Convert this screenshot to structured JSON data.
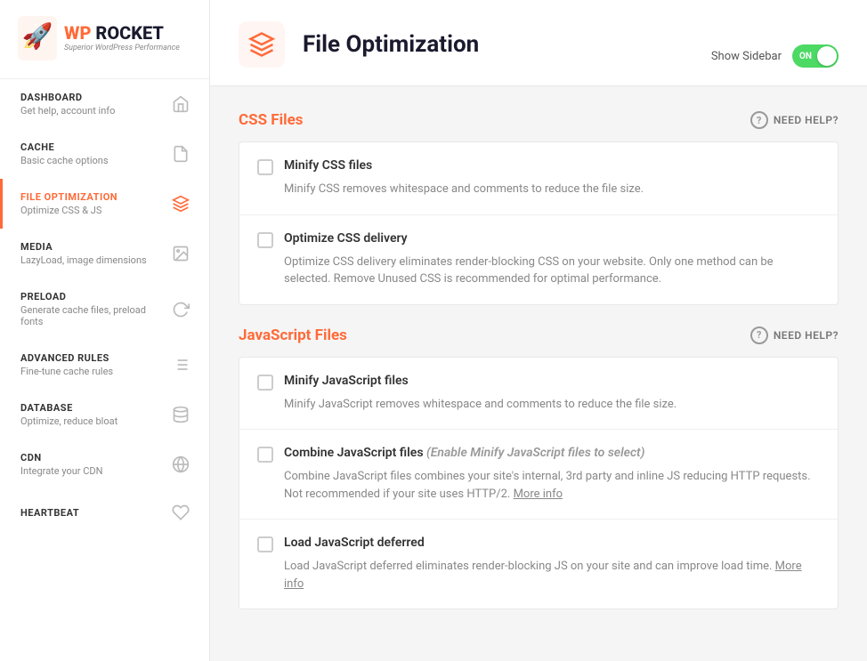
{
  "logo": {
    "wp": "WP",
    "rocket": "ROCKET",
    "subtitle": "Superior WordPress Performance"
  },
  "sidebar": {
    "items": [
      {
        "id": "dashboard",
        "title": "DASHBOARD",
        "desc": "Get help, account info",
        "icon": "house"
      },
      {
        "id": "cache",
        "title": "CACHE",
        "desc": "Basic cache options",
        "icon": "file"
      },
      {
        "id": "file-optimization",
        "title": "FILE OPTIMIZATION",
        "desc": "Optimize CSS & JS",
        "icon": "layers",
        "active": true
      },
      {
        "id": "media",
        "title": "MEDIA",
        "desc": "LazyLoad, image dimensions",
        "icon": "image"
      },
      {
        "id": "preload",
        "title": "PRELOAD",
        "desc": "Generate cache files, preload fonts",
        "icon": "refresh"
      },
      {
        "id": "advanced-rules",
        "title": "ADVANCED RULES",
        "desc": "Fine-tune cache rules",
        "icon": "list"
      },
      {
        "id": "database",
        "title": "DATABASE",
        "desc": "Optimize, reduce bloat",
        "icon": "database"
      },
      {
        "id": "cdn",
        "title": "CDN",
        "desc": "Integrate your CDN",
        "icon": "globe"
      },
      {
        "id": "heartbeat",
        "title": "HEARTBEAT",
        "desc": "",
        "icon": "heart"
      }
    ]
  },
  "header": {
    "title": "File Optimization",
    "show_sidebar_label": "Show Sidebar",
    "toggle_label": "ON"
  },
  "tabs": [
    {
      "id": "tab1",
      "label": ""
    }
  ],
  "css_section": {
    "title": "CSS Files",
    "need_help": "NEED HELP?",
    "rows": [
      {
        "id": "minify-css",
        "title": "Minify CSS files",
        "desc": "Minify CSS removes whitespace and comments to reduce the file size.",
        "checked": false
      },
      {
        "id": "optimize-css-delivery",
        "title": "Optimize CSS delivery",
        "desc": "Optimize CSS delivery eliminates render-blocking CSS on your website. Only one method can be selected. Remove Unused CSS is recommended for optimal performance.",
        "checked": false
      }
    ]
  },
  "js_section": {
    "title": "JavaScript Files",
    "need_help": "NEED HELP?",
    "rows": [
      {
        "id": "minify-js",
        "title": "Minify JavaScript files",
        "desc": "Minify JavaScript removes whitespace and comments to reduce the file size.",
        "checked": false
      },
      {
        "id": "combine-js",
        "title": "Combine JavaScript files",
        "title_note": "(Enable Minify JavaScript files to select)",
        "desc": "Combine JavaScript files combines your site's internal, 3rd party and inline JS reducing HTTP requests. Not recommended if your site uses HTTP/2.",
        "desc_link": "More info",
        "checked": false
      },
      {
        "id": "load-js-deferred",
        "title": "Load JavaScript deferred",
        "desc": "Load JavaScript deferred eliminates render-blocking JS on your site and can improve load time.",
        "desc_link_more": "More info",
        "checked": false
      }
    ]
  }
}
